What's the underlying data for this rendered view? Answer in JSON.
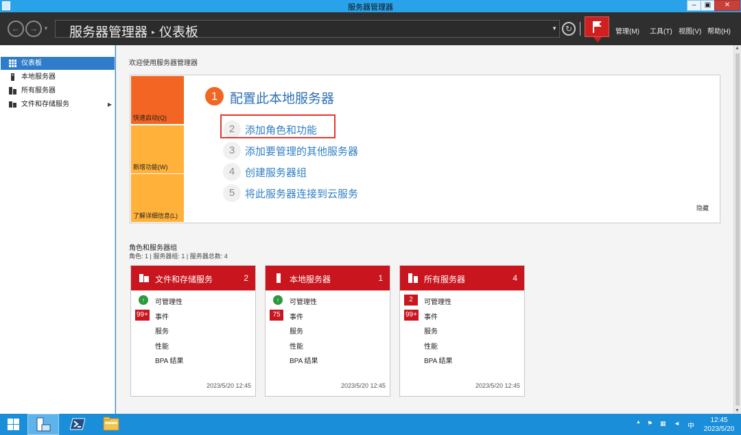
{
  "window": {
    "title": "服务器管理器",
    "controls": {
      "minimize": "–",
      "maximize": "▣",
      "close": "✕"
    }
  },
  "nav": {
    "breadcrumb_root": "服务器管理器",
    "breadcrumb_separator": "▸",
    "breadcrumb_current": "仪表板",
    "menus": [
      "管理(M)",
      "工具(T)",
      "视图(V)",
      "帮助(H)"
    ]
  },
  "sidebar": {
    "items": [
      {
        "label": "仪表板",
        "icon": "dashboard-icon",
        "selected": true
      },
      {
        "label": "本地服务器",
        "icon": "server-icon",
        "selected": false
      },
      {
        "label": "所有服务器",
        "icon": "servers-icon",
        "selected": false
      },
      {
        "label": "文件和存储服务",
        "icon": "storage-icon",
        "selected": false,
        "expandable": true
      }
    ]
  },
  "welcome": {
    "heading": "欢迎使用服务器管理器",
    "tiles": [
      "快速启动(Q)",
      "新增功能(W)",
      "了解详细信息(L)"
    ],
    "step1": {
      "number": "1",
      "text": "配置此本地服务器"
    },
    "steps": [
      {
        "number": "2",
        "text": "添加角色和功能",
        "highlighted": true
      },
      {
        "number": "3",
        "text": "添加要管理的其他服务器"
      },
      {
        "number": "4",
        "text": "创建服务器组"
      },
      {
        "number": "5",
        "text": "将此服务器连接到云服务"
      }
    ],
    "hide_label": "隐藏"
  },
  "roles": {
    "title": "角色和服务器组",
    "summary": "角色: 1 | 服务器组: 1 | 服务器总数: 4",
    "row_labels": [
      "可管理性",
      "事件",
      "服务",
      "性能",
      "BPA 结果"
    ],
    "cards": [
      {
        "name": "文件和存储服务",
        "count": "2",
        "manageability": "ok",
        "events_badge": "99+",
        "timestamp": "2023/5/20 12:45"
      },
      {
        "name": "本地服务器",
        "count": "1",
        "manageability": "ok",
        "events_badge": "75",
        "timestamp": "2023/5/20 12:45"
      },
      {
        "name": "所有服务器",
        "count": "4",
        "manageability_badge": "2",
        "events_badge": "99+",
        "timestamp": "2023/5/20 12:45"
      }
    ]
  },
  "taskbar": {
    "tray_ime": "中",
    "clock_time": "12:45",
    "clock_date": "2023/5/20"
  },
  "colors": {
    "accent_orange": "#f26522",
    "tile_yellow": "#ffb13a",
    "card_red": "#c9151e",
    "link_blue": "#2f7fc3",
    "selected_blue": "#2f7dca",
    "taskbar_blue": "#1a8ed9"
  }
}
